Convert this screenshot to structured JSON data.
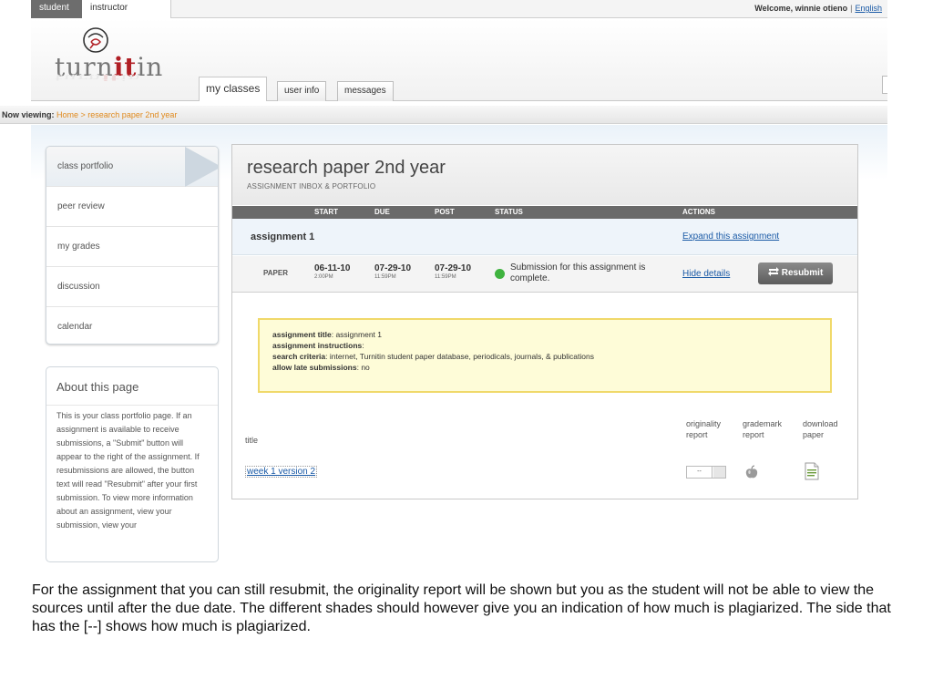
{
  "roles": {
    "active": "student",
    "inactive": "instructor"
  },
  "user": {
    "welcome": "Welcome, winnie otieno",
    "separator": "|",
    "language": "English"
  },
  "logo": {
    "prefix": "turn",
    "bold": "it",
    "suffix": "in"
  },
  "nav": {
    "tabs": [
      "my classes",
      "user info",
      "messages"
    ]
  },
  "breadcrumb": {
    "label": "Now viewing:",
    "path": "Home > research paper 2nd year"
  },
  "sidebar": {
    "items": [
      "class portfolio",
      "peer review",
      "my grades",
      "discussion",
      "calendar"
    ],
    "about_title": "About this page",
    "about_text": "This is your class portfolio page. If an assignment is available to receive submissions, a \"Submit\" button will appear to the right of the assignment. If resubmissions are allowed, the button text will read \"Resubmit\" after your first submission. To view more information about an assignment, view your submission, view your"
  },
  "panel": {
    "title": "research paper 2nd year",
    "subtitle": "ASSIGNMENT INBOX & PORTFOLIO",
    "columns": {
      "start": "START",
      "due": "DUE",
      "post": "POST",
      "status": "STATUS",
      "actions": "ACTIONS"
    },
    "assignment": {
      "name": "assignment 1",
      "expand_link": "Expand this assignment",
      "type": "PAPER",
      "start": {
        "date": "06-11-10",
        "time": "2:00PM"
      },
      "due": {
        "date": "07-29-10",
        "time": "11:59PM"
      },
      "post": {
        "date": "07-29-10",
        "time": "11:59PM"
      },
      "status": "Submission for this assignment is complete.",
      "status_color": "#3fb33f",
      "hide_link": "Hide details",
      "resubmit_label": "Resubmit"
    },
    "info": {
      "title_label": "assignment title",
      "title_value": ": assignment 1",
      "instructions_label": "assignment instructions",
      "instructions_value": ":",
      "criteria_label": "search criteria",
      "criteria_value": ": internet, Turnitin student paper database, periodicals, journals, & publications",
      "late_label": "allow late submissions",
      "late_value": ": no"
    },
    "table": {
      "title_header": "title",
      "originality_header": "originality report",
      "grademark_header": "grademark report",
      "download_header": "download paper",
      "rows": [
        {
          "title": "week 1 version 2",
          "originality": "--"
        }
      ]
    }
  },
  "caption": "For the assignment that you can still resubmit, the originality report will be shown but you as the student will not be able to view the sources until after the due date. The different shades should however give you an indication  of how much is plagiarized. The  side that has the [--] shows how much is plagiarized."
}
